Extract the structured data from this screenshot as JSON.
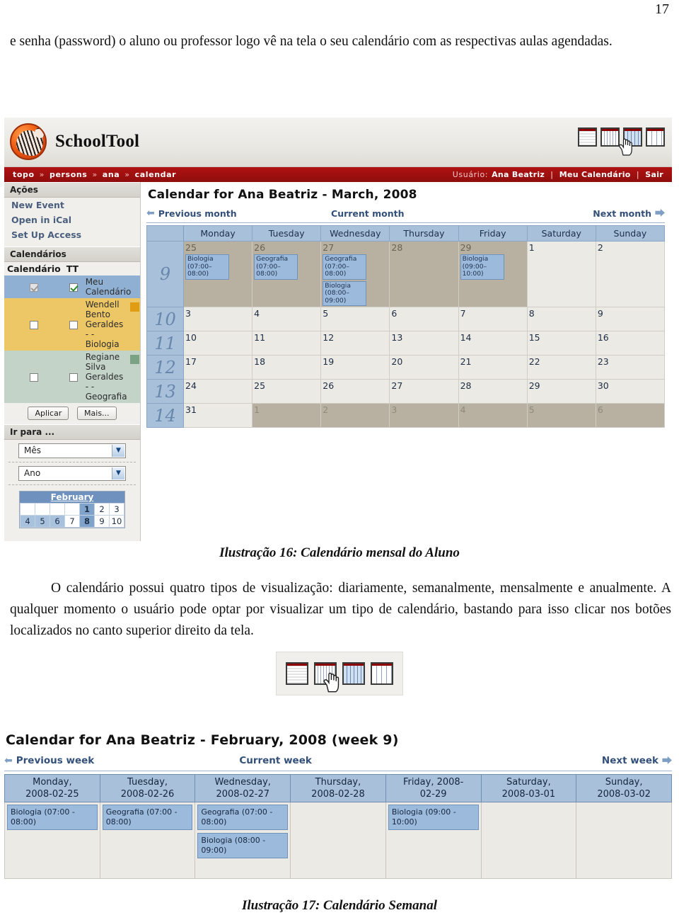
{
  "document": {
    "page_number": "17",
    "intro_paragraph": "e senha (password) o aluno ou professor logo vê na tela o seu calendário com as respectivas aulas agendadas.",
    "caption_16": "Ilustração 16: Calendário mensal do Aluno",
    "mid_paragraph": "O calendário possui quatro tipos de visualização: diariamente, semanalmente, mensalmente e anualmente. A qualquer momento o usuário pode optar por visualizar um tipo de calendário, bastando para isso clicar nos botões localizados no canto superior direito da tela.",
    "caption_17": "Ilustração 17: Calendário Semanal"
  },
  "app": {
    "title": "SchoolTool",
    "logo_icon": "zebra-logo-icon",
    "breadcrumb": [
      "topo",
      "persons",
      "ana",
      "calendar"
    ],
    "breadcrumb_separator": "»",
    "user_label": "Usuário:",
    "user_name": "Ana Beatriz",
    "my_calendar_link": "Meu Calendário",
    "logout_link": "Sair",
    "view_icons": [
      {
        "name": "daily-view-icon",
        "title": "Daily"
      },
      {
        "name": "weekly-view-icon",
        "title": "Weekly"
      },
      {
        "name": "monthly-view-icon",
        "title": "Monthly"
      },
      {
        "name": "yearly-view-icon",
        "title": "Yearly"
      }
    ]
  },
  "sidebar": {
    "actions_header": "Ações",
    "actions": [
      {
        "label": "New Event"
      },
      {
        "label": "Open in iCal"
      },
      {
        "label": "Set Up Access"
      }
    ],
    "calendars_header": "Calendários",
    "col_calendar": "Calendário",
    "col_tt": "TT",
    "calendars": [
      {
        "label": "Meu Calendário",
        "checked_cal": true,
        "checked_tt": true,
        "color": "#8fb0d3",
        "swatch": ""
      },
      {
        "label": "Wendell Bento Geraldes - - Biologia",
        "checked_cal": false,
        "checked_tt": false,
        "color": "#edc765",
        "swatch": "#e09c13"
      },
      {
        "label": "Regiane Silva Geraldes - - Geografia",
        "checked_cal": false,
        "checked_tt": false,
        "color": "#c3d3c8",
        "swatch": "#7ba285"
      }
    ],
    "apply_button": "Aplicar",
    "more_button": "Mais...",
    "goto_header": "Ir para ...",
    "month_select": "Mês",
    "year_select": "Ano",
    "mini_calendar": {
      "title": "February",
      "weeks": [
        [
          {
            "d": "",
            "hl": false
          },
          {
            "d": "",
            "hl": false
          },
          {
            "d": "",
            "hl": false
          },
          {
            "d": "",
            "hl": false
          },
          {
            "d": "1",
            "hl": true,
            "today": true
          },
          {
            "d": "2",
            "hl": false
          },
          {
            "d": "3",
            "hl": false
          }
        ],
        [
          {
            "d": "4",
            "hl": true
          },
          {
            "d": "5",
            "hl": true
          },
          {
            "d": "6",
            "hl": true
          },
          {
            "d": "7",
            "hl": false
          },
          {
            "d": "8",
            "hl": true,
            "today": true
          },
          {
            "d": "9",
            "hl": false
          },
          {
            "d": "10",
            "hl": false
          }
        ]
      ]
    }
  },
  "month_view": {
    "title": "Calendar for Ana Beatriz - March, 2008",
    "prev_label": "Previous month",
    "current_label": "Current month",
    "next_label": "Next month",
    "weekday_headers": [
      "Monday",
      "Tuesday",
      "Wednesday",
      "Thursday",
      "Friday",
      "Saturday",
      "Sunday"
    ],
    "weeks": [
      {
        "number": "9",
        "tall": true,
        "days": [
          {
            "n": "25",
            "state": "past",
            "events": [
              {
                "t": "Biologia (07:00–08:00)"
              }
            ]
          },
          {
            "n": "26",
            "state": "past",
            "events": [
              {
                "t": "Geografia (07:00–08:00)"
              }
            ]
          },
          {
            "n": "27",
            "state": "past",
            "events": [
              {
                "t": "Geografia (07:00–08:00)"
              },
              {
                "t": "Biologia (08:00–09:00)"
              }
            ]
          },
          {
            "n": "28",
            "state": "past",
            "events": []
          },
          {
            "n": "29",
            "state": "past",
            "events": [
              {
                "t": "Biologia (09:00–10:00)"
              }
            ]
          },
          {
            "n": "1",
            "state": "normal",
            "events": []
          },
          {
            "n": "2",
            "state": "normal",
            "events": []
          }
        ]
      },
      {
        "number": "10",
        "tall": false,
        "days": [
          {
            "n": "3",
            "state": "normal",
            "events": []
          },
          {
            "n": "4",
            "state": "normal",
            "events": []
          },
          {
            "n": "5",
            "state": "normal",
            "events": []
          },
          {
            "n": "6",
            "state": "normal",
            "events": []
          },
          {
            "n": "7",
            "state": "normal",
            "events": []
          },
          {
            "n": "8",
            "state": "normal",
            "events": []
          },
          {
            "n": "9",
            "state": "normal",
            "events": []
          }
        ]
      },
      {
        "number": "11",
        "tall": false,
        "days": [
          {
            "n": "10",
            "state": "normal",
            "events": []
          },
          {
            "n": "11",
            "state": "normal",
            "events": []
          },
          {
            "n": "12",
            "state": "normal",
            "events": []
          },
          {
            "n": "13",
            "state": "normal",
            "events": []
          },
          {
            "n": "14",
            "state": "normal",
            "events": []
          },
          {
            "n": "15",
            "state": "normal",
            "events": []
          },
          {
            "n": "16",
            "state": "normal",
            "events": []
          }
        ]
      },
      {
        "number": "12",
        "tall": false,
        "days": [
          {
            "n": "17",
            "state": "normal",
            "events": []
          },
          {
            "n": "18",
            "state": "normal",
            "events": []
          },
          {
            "n": "19",
            "state": "normal",
            "events": []
          },
          {
            "n": "20",
            "state": "normal",
            "events": []
          },
          {
            "n": "21",
            "state": "normal",
            "events": []
          },
          {
            "n": "22",
            "state": "normal",
            "events": []
          },
          {
            "n": "23",
            "state": "normal",
            "events": []
          }
        ]
      },
      {
        "number": "13",
        "tall": false,
        "days": [
          {
            "n": "24",
            "state": "normal",
            "events": []
          },
          {
            "n": "25",
            "state": "normal",
            "events": []
          },
          {
            "n": "26",
            "state": "normal",
            "events": []
          },
          {
            "n": "27",
            "state": "normal",
            "events": []
          },
          {
            "n": "28",
            "state": "normal",
            "events": []
          },
          {
            "n": "29",
            "state": "normal",
            "events": []
          },
          {
            "n": "30",
            "state": "normal",
            "events": []
          }
        ]
      },
      {
        "number": "14",
        "tall": false,
        "days": [
          {
            "n": "31",
            "state": "normal",
            "events": []
          },
          {
            "n": "1",
            "state": "out",
            "events": []
          },
          {
            "n": "2",
            "state": "out",
            "events": []
          },
          {
            "n": "3",
            "state": "out",
            "events": []
          },
          {
            "n": "4",
            "state": "out",
            "events": []
          },
          {
            "n": "5",
            "state": "out",
            "events": []
          },
          {
            "n": "6",
            "state": "out",
            "events": []
          }
        ]
      }
    ]
  },
  "week_view": {
    "title": "Calendar for Ana Beatriz - February, 2008 (week 9)",
    "prev_label": "Previous week",
    "current_label": "Current week",
    "next_label": "Next week",
    "columns": [
      {
        "day": "Monday,",
        "date": "2008-02-25",
        "events": [
          {
            "t": "Biologia (07:00 - 08:00)"
          }
        ]
      },
      {
        "day": "Tuesday,",
        "date": "2008-02-26",
        "events": [
          {
            "t": "Geografia (07:00 - 08:00)"
          }
        ]
      },
      {
        "day": "Wednesday,",
        "date": "2008-02-27",
        "events": [
          {
            "t": "Geografia (07:00 - 08:00)"
          },
          {
            "t": "Biologia (08:00 - 09:00)"
          }
        ]
      },
      {
        "day": "Thursday,",
        "date": "2008-02-28",
        "events": []
      },
      {
        "day": "Friday, 2008-",
        "date": "02-29",
        "events": [
          {
            "t": "Biologia (09:00 - 10:00)"
          }
        ]
      },
      {
        "day": "Saturday,",
        "date": "2008-03-01",
        "events": []
      },
      {
        "day": "Sunday,",
        "date": "2008-03-02",
        "events": []
      }
    ]
  },
  "colors": {
    "brand_red": "#a51111",
    "header_blue": "#a8c0d9",
    "event_blue": "#9cbadb",
    "past_tan": "#b8b1a1",
    "cell_bg": "#eceae4"
  }
}
